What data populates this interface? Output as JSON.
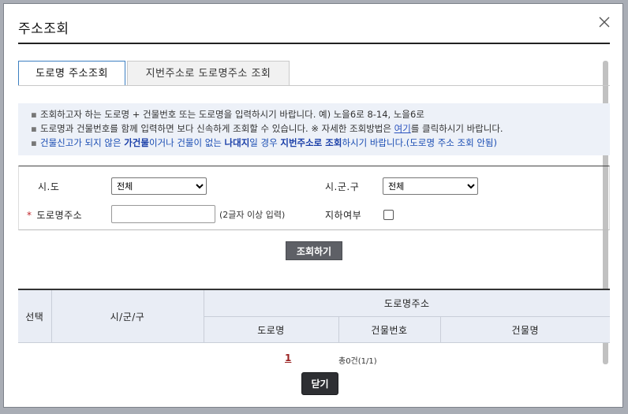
{
  "dialog": {
    "title": "주소조회",
    "close_icon": "close-icon"
  },
  "tabs": [
    {
      "label": "도로명 주소조회",
      "active": true
    },
    {
      "label": "지번주소로 도로명주소 조회",
      "active": false
    }
  ],
  "notice": {
    "bullet": "▪",
    "line1": "조회하고자 하는 도로명 + 건물번호 또는 도로명을 입력하시기 바랍니다. 예) 노을6로 8-14, 노을6로",
    "line2_before": "도로명과 건물번호를 함께 입력하면 보다 신속하게 조회할 수 있습니다. ※ 자세한 조회방법은 ",
    "line2_link": "여기",
    "line2_after": "를 클릭하시기 바랍니다.",
    "line3_a": "건물신고가 되지 않은 ",
    "line3_b": "가건물",
    "line3_c": "이거나 건물이 없는 ",
    "line3_d": "나대지",
    "line3_e": "일 경우 ",
    "line3_f": "지번주소로 조회",
    "line3_g": "하시기 바랍니다.(도로명 주소 조회 안됨)"
  },
  "form": {
    "sido_label": "시.도",
    "sido_value": "전체",
    "sigungu_label": "시.군.구",
    "sigungu_value": "전체",
    "required_mark": "*",
    "road_label": "도로명주소",
    "road_value": "",
    "road_hint": "(2글자 이상 입력)",
    "underground_label": "지하여부",
    "underground_checked": false
  },
  "search_button": "조회하기",
  "table": {
    "col_select": "선택",
    "col_sigungu": "시/군/구",
    "col_road_address": "도로명주소",
    "col_road": "도로명",
    "col_building_no": "건물번호",
    "col_building_name": "건물명",
    "rows": []
  },
  "pagination": {
    "current_page": "1",
    "total_text": "총0건(1/1)"
  },
  "close_button": "닫기"
}
